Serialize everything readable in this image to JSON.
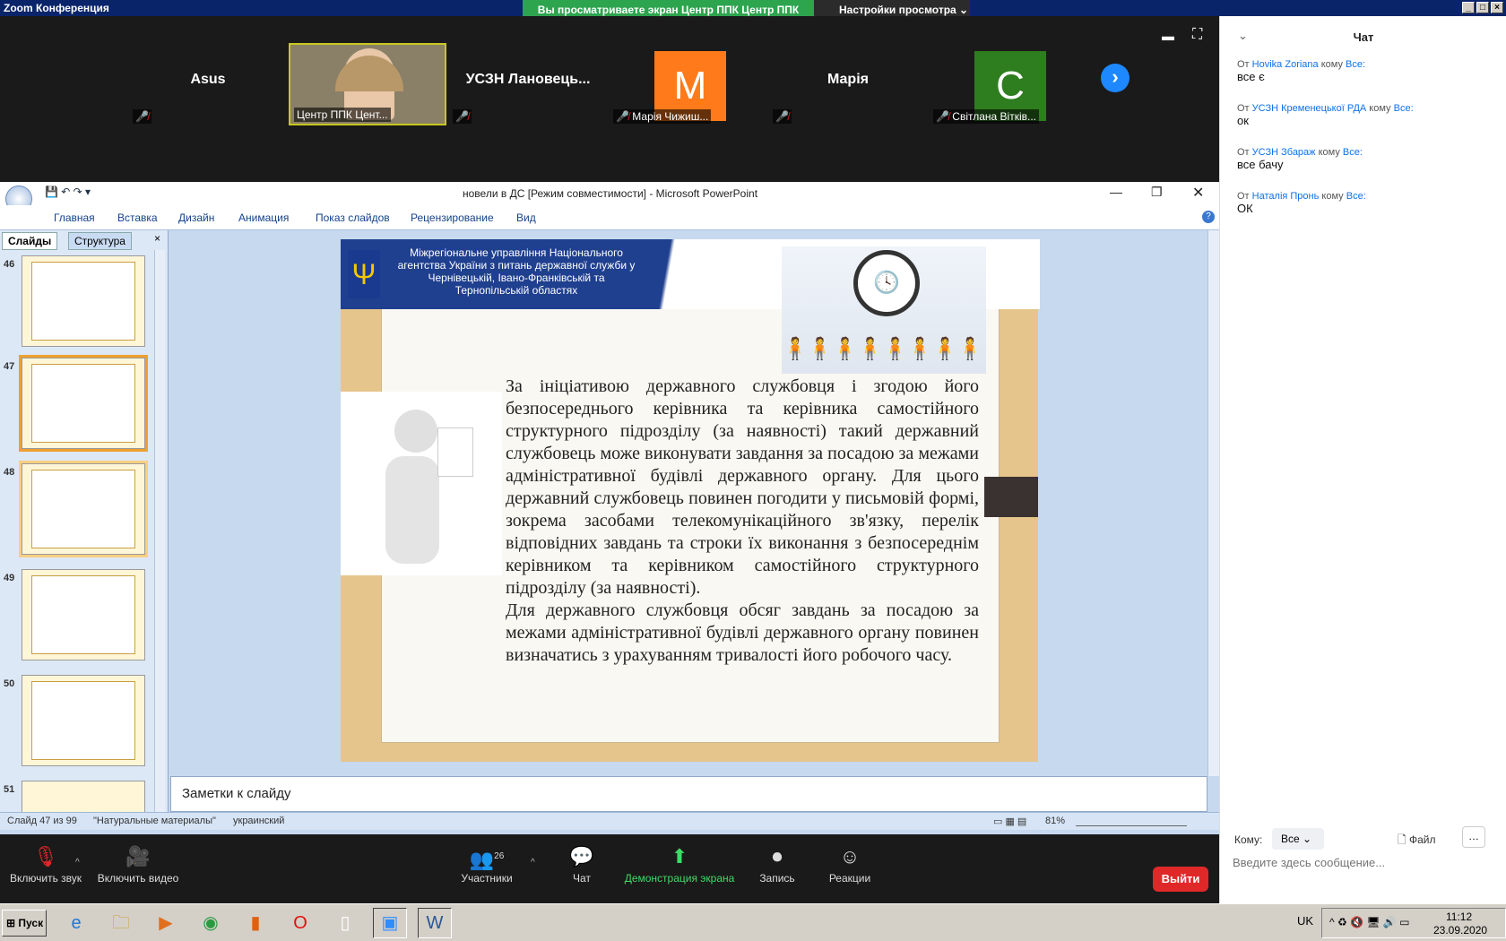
{
  "window": {
    "title": "Zoom Конференция",
    "banner": "Вы просматриваете экран Центр ППК Центр ППК",
    "view_options": "Настройки просмотра"
  },
  "participants": [
    {
      "name": "Asus",
      "label": ""
    },
    {
      "name": "",
      "label": "Центр ППК Цент..."
    },
    {
      "name": "УСЗН  Лановець...",
      "label": ""
    },
    {
      "name": "M",
      "label": "Марія Чижиш..."
    },
    {
      "name": "Марія",
      "label": ""
    },
    {
      "name": "C",
      "label": "Світлана Вітків..."
    }
  ],
  "ppt": {
    "title": "новели в ДС [Режим совместимости] - Microsoft PowerPoint",
    "tabs": [
      "Главная",
      "Вставка",
      "Дизайн",
      "Анимация",
      "Показ слайдов",
      "Рецензирование",
      "Вид"
    ],
    "pane_tabs": [
      "Слайды",
      "Структура"
    ],
    "thumbs": [
      "46",
      "47",
      "48",
      "49",
      "50",
      "51"
    ],
    "notes_placeholder": "Заметки к слайду",
    "status": {
      "slide": "Слайд 47 из 99",
      "theme": "\"Натуральные материалы\"",
      "lang": "украинский",
      "zoom": "81%"
    }
  },
  "slide": {
    "header": "Міжрегіональне управління Національного агентства України з питань державної служби  у Чернівецькій, Івано-Франківській та Тернопільській областях",
    "body1": "За ініціативою державного службовця і згодою його безпосереднього керівника та керівника самостійного структурного підрозділу (за наявності) такий державний службовець може виконувати завдання за посадою за межами адміністративної будівлі державного органу. Для цього державний службовець повинен погодити у письмовій формі, зокрема засобами телекомунікаційного зв'язку, перелік відповідних завдань та строки їх виконання з безпосереднім керівником та керівником самостійного структурного підрозділу (за наявності).",
    "body2": "Для державного службовця обсяг завдань за посадою за межами адміністративної будівлі державного органу повинен визначатись з урахуванням тривалості його робочого часу."
  },
  "chat": {
    "title": "Чат",
    "messages": [
      {
        "from_prefix": "От",
        "from": "Hovika Zoriana",
        "to_prefix": "кому",
        "to": "Все:",
        "text": "все є"
      },
      {
        "from_prefix": "От",
        "from": "УСЗН Кременецької РДА",
        "to_prefix": "кому",
        "to": "Все:",
        "text": "ок"
      },
      {
        "from_prefix": "От",
        "from": "УСЗН Збараж",
        "to_prefix": "кому",
        "to": "Все:",
        "text": "все бачу"
      },
      {
        "from_prefix": "От",
        "from": "Наталія Пронь",
        "to_prefix": "кому",
        "to": "Все:",
        "text": "ОК"
      }
    ],
    "to_label": "Кому:",
    "to_value": "Все",
    "file_label": "Файл",
    "input_placeholder": "Введите здесь сообщение..."
  },
  "toolbar": {
    "mic": "Включить звук",
    "video": "Включить видео",
    "participants": "Участники",
    "participants_count": "26",
    "chat": "Чат",
    "share": "Демонстрация экрана",
    "record": "Запись",
    "reactions": "Реакции",
    "leave": "Выйти"
  },
  "taskbar": {
    "start": "Пуск",
    "lang": "UK",
    "time": "11:12",
    "date": "23.09.2020"
  },
  "colors": {
    "zoom_blue": "#0e71eb",
    "banner_green": "#2da44e",
    "leave_red": "#e02828",
    "slide_blue": "#1f3f8f"
  }
}
